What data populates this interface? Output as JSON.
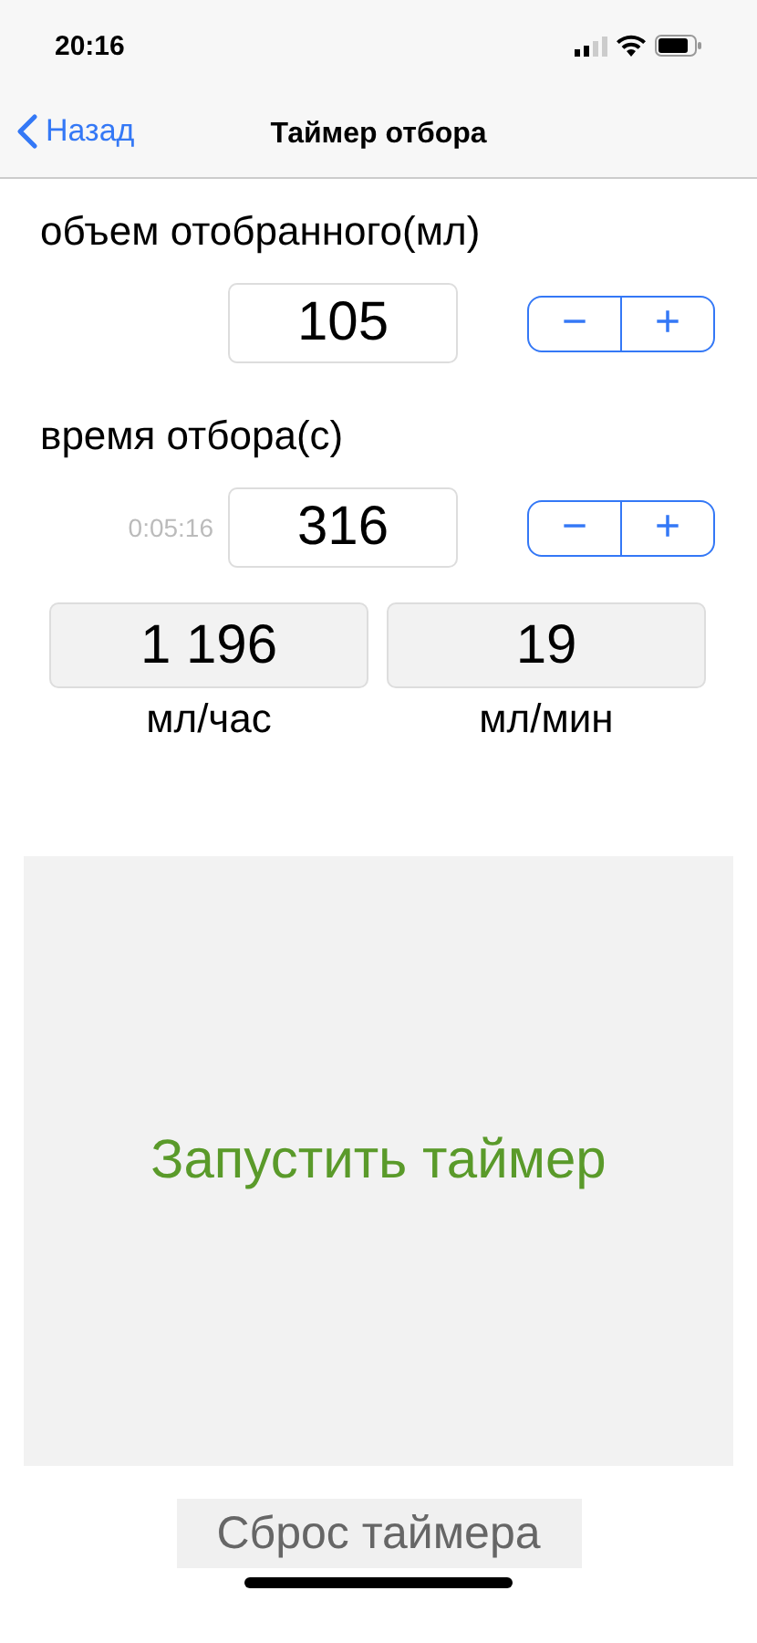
{
  "status_bar": {
    "time": "20:16"
  },
  "nav": {
    "back": "Назад",
    "title": "Таймер отбора"
  },
  "volume": {
    "label": "объем отобранного(мл)",
    "value": "105",
    "minus": "−",
    "plus": "+"
  },
  "duration": {
    "label": "время отбора(с)",
    "hint": "0:05:16",
    "value": "316",
    "minus": "−",
    "plus": "+"
  },
  "results": [
    {
      "value": "1 196",
      "unit": "мл/час"
    },
    {
      "value": "19",
      "unit": "мл/мин"
    }
  ],
  "start_button": "Запустить таймер",
  "reset_button": "Сброс таймера"
}
